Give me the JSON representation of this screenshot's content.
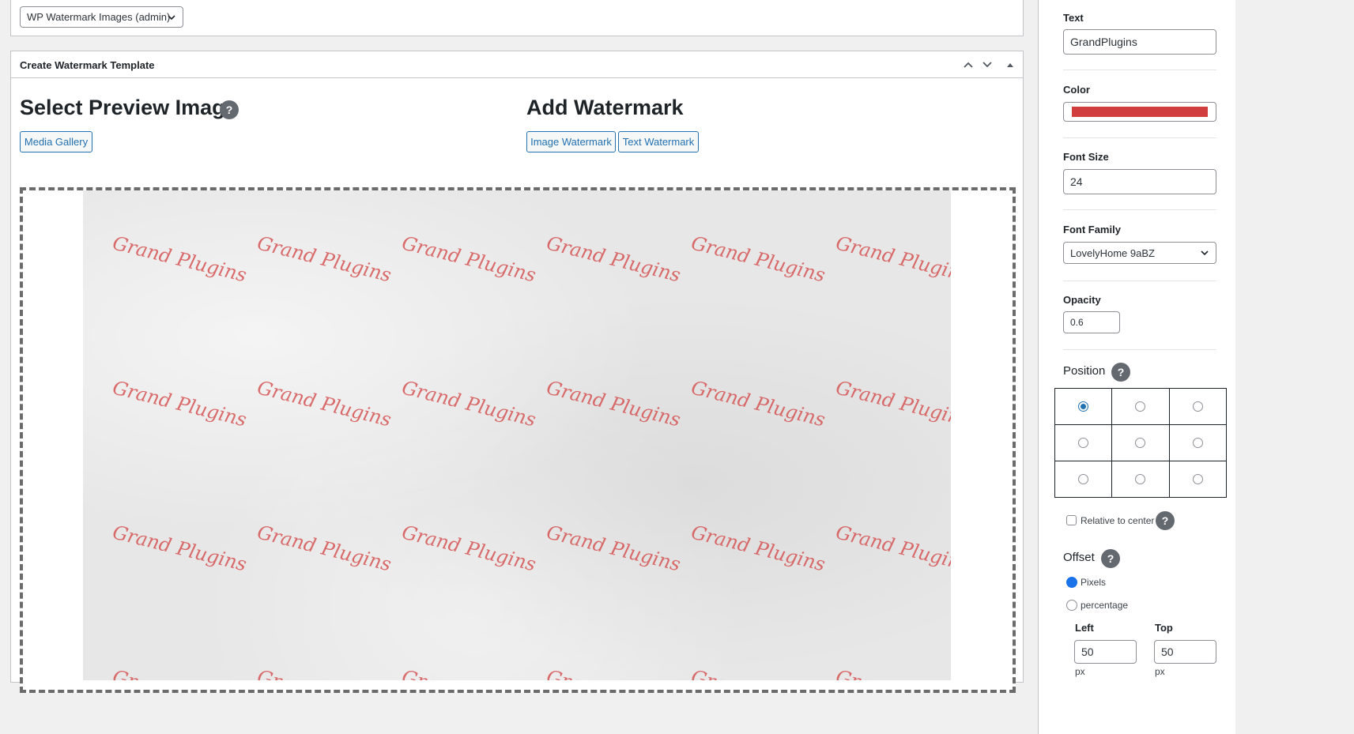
{
  "top_select": {
    "value": "WP Watermark Images (admin)"
  },
  "template_box": {
    "title": "Create Watermark Template",
    "select_preview_heading": "Select Preview Image",
    "media_gallery_label": "Media Gallery",
    "add_watermark_heading": "Add Watermark",
    "image_watermark_label": "Image Watermark",
    "text_watermark_label": "Text Watermark",
    "help_glyph": "?"
  },
  "preview": {
    "watermark_text": "Grand Plugins",
    "watermark_color": "#d65454"
  },
  "panel": {
    "text_label": "Text",
    "text_value": "GrandPlugins",
    "color_label": "Color",
    "color_value": "#d13e3e",
    "font_size_label": "Font Size",
    "font_size_value": "24",
    "font_family_label": "Font Family",
    "font_family_value": "LovelyHome 9aBZ",
    "opacity_label": "Opacity",
    "opacity_value": "0.6",
    "position_label": "Position",
    "position_selected": 0,
    "relative_label": "Relative to center",
    "offset_label": "Offset",
    "offset_pixels": "Pixels",
    "offset_percentage": "percentage",
    "left_label": "Left",
    "left_value": "50",
    "top_label": "Top",
    "top_value": "50",
    "unit": "px",
    "help_glyph": "?"
  }
}
